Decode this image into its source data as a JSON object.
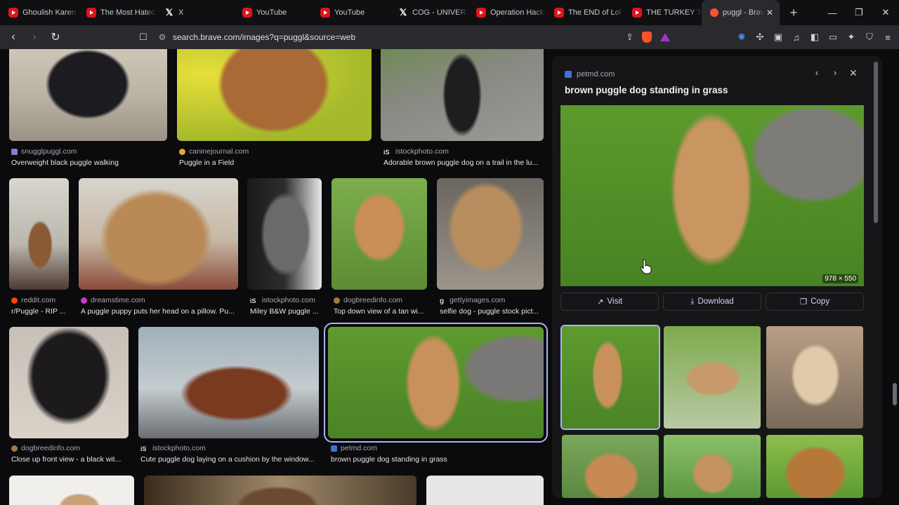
{
  "browser": {
    "tabs": [
      {
        "title": "Ghoulish Karen",
        "icon": "youtube-icon"
      },
      {
        "title": "The Most Hated",
        "icon": "youtube-icon"
      },
      {
        "title": "X",
        "icon": "x-icon"
      },
      {
        "title": "YouTube",
        "icon": "youtube-icon"
      },
      {
        "title": "YouTube",
        "icon": "youtube-icon"
      },
      {
        "title": "COG - UNIVERS",
        "icon": "x-icon"
      },
      {
        "title": "Operation Hack",
        "icon": "youtube-icon"
      },
      {
        "title": "The END of Lol",
        "icon": "youtube-icon"
      },
      {
        "title": "THE TURKEY TO",
        "icon": "youtube-icon"
      },
      {
        "title": "puggl - Brave",
        "icon": "brave-search-icon",
        "active": true
      }
    ],
    "url": "search.brave.com/images?q=puggl&source=web"
  },
  "results": [
    {
      "domain": "snugglpuggl.com",
      "caption": "Overweight black puggle walking"
    },
    {
      "domain": "caninejournal.com",
      "caption": "Puggle in a Field"
    },
    {
      "domain": "istockphoto.com",
      "caption": "Adorable brown puggle dog on a trail in the lu..."
    },
    {
      "domain": "reddit.com",
      "caption": "r/Puggle - RIP ..."
    },
    {
      "domain": "dreamstime.com",
      "caption": "A puggle puppy puts her head on a pillow. Pu..."
    },
    {
      "domain": "istockphoto.com",
      "caption": "Miley B&W puggle ..."
    },
    {
      "domain": "dogbreedinfo.com",
      "caption": "Top down view of a tan wi..."
    },
    {
      "domain": "gettyimages.com",
      "caption": "selfie dog - puggle stock pict..."
    },
    {
      "domain": "dogbreedinfo.com",
      "caption": "Close up front view - a black wit..."
    },
    {
      "domain": "istockphoto.com",
      "caption": "Cute puggle dog laying on a cushion by the window..."
    },
    {
      "domain": "petmd.com",
      "caption": "brown puggle dog standing in grass"
    }
  ],
  "panel": {
    "domain": "petmd.com",
    "title": "brown puggle dog standing in grass",
    "dimensions": "978 × 550",
    "visit": "Visit",
    "download": "Download",
    "copy": "Copy"
  }
}
